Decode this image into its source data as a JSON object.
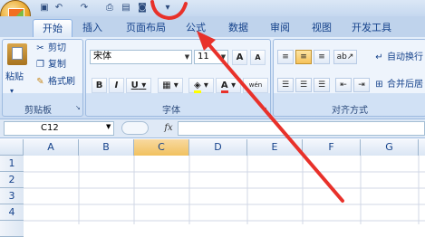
{
  "tabs": [
    {
      "label": "开始",
      "active": true
    },
    {
      "label": "插入",
      "active": false
    },
    {
      "label": "页面布局",
      "active": false
    },
    {
      "label": "公式",
      "active": false
    },
    {
      "label": "数据",
      "active": false
    },
    {
      "label": "审阅",
      "active": false
    },
    {
      "label": "视图",
      "active": false
    },
    {
      "label": "开发工具",
      "active": false
    }
  ],
  "clipboard": {
    "paste": "粘贴",
    "cut": "剪切",
    "copy": "复制",
    "format_painter": "格式刷",
    "group_label": "剪贴板"
  },
  "font": {
    "name": "宋体",
    "size": "11",
    "grow": "A",
    "shrink": "A",
    "bold": "B",
    "italic": "I",
    "underline": "U",
    "font_color": "A",
    "phonetic": "wén",
    "group_label": "字体"
  },
  "alignment": {
    "wrap_text": "自动换行",
    "merge_center": "合并后居",
    "group_label": "对齐方式"
  },
  "formula_bar": {
    "name_box": "C12",
    "fx": "fx",
    "value": ""
  },
  "sheet": {
    "columns": [
      "A",
      "B",
      "C",
      "D",
      "E",
      "F",
      "G"
    ],
    "selected_column": "C",
    "rows": [
      "1",
      "2",
      "3",
      "4"
    ]
  },
  "colors": {
    "accent": "#15428b",
    "annotation": "#e8312a",
    "selected_header": "#f1c15f"
  },
  "icons": [
    "office-logo-icon",
    "save-icon",
    "undo-icon",
    "redo-icon",
    "print-icon",
    "customize-icon",
    "scissors-icon",
    "copy-icon",
    "brush-icon",
    "paste-icon",
    "border-icon",
    "fill-color-icon",
    "font-color-icon",
    "orientation-icon",
    "indent-icon",
    "fx-icon"
  ]
}
